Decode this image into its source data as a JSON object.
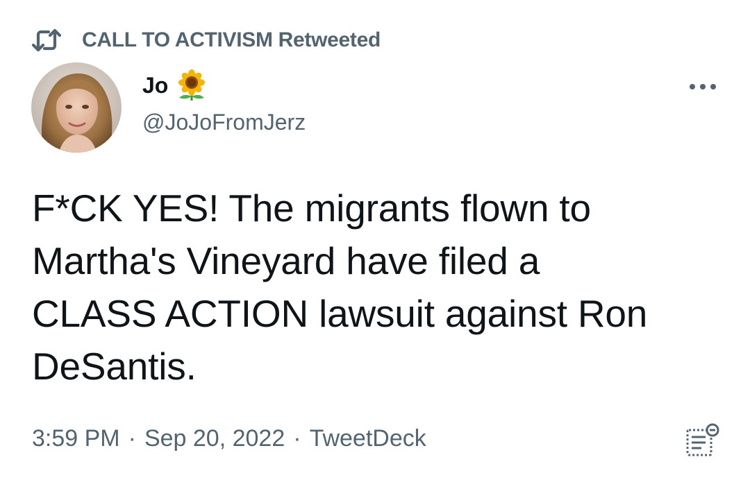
{
  "retweet_header": {
    "icon": "retweet-icon",
    "text": "CALL TO ACTIVISM Retweeted"
  },
  "author": {
    "avatar_icon": "avatar",
    "display_name": "Jo",
    "name_emoji_icon": "sunflower-icon",
    "handle": "@JoJoFromJerz"
  },
  "more_menu_icon": "more-horizontal-icon",
  "tweet": {
    "lines": [
      "F*CK YES! The migrants flown to",
      "Martha's Vineyard have filed a",
      "CLASS ACTION lawsuit against Ron",
      "DeSantis."
    ]
  },
  "meta": {
    "time": "3:59 PM",
    "separator": "·",
    "date": "Sep 20, 2022",
    "source": "TweetDeck"
  },
  "analytics_icon": "analytics-icon",
  "colors": {
    "text_primary": "#0f1419",
    "text_secondary": "#536471",
    "background": "#ffffff",
    "retweet_green": "#536471"
  }
}
